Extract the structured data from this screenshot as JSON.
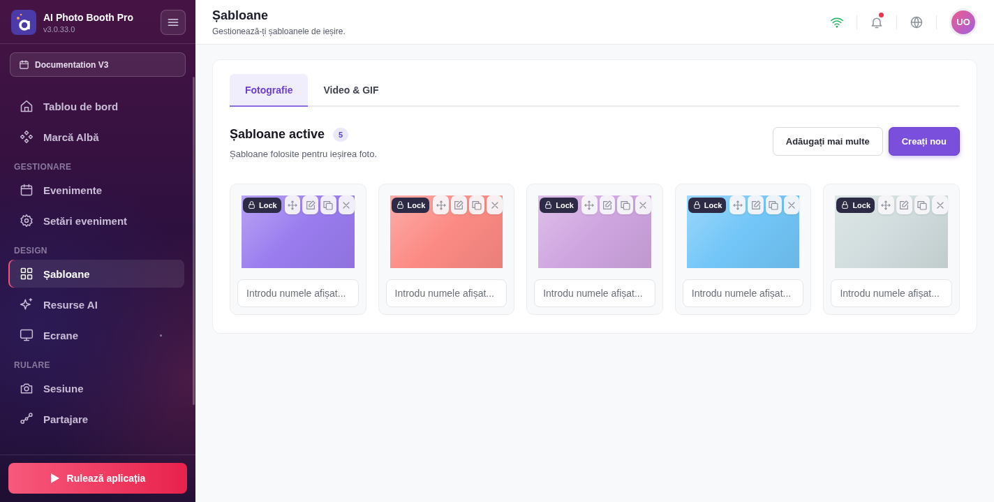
{
  "app": {
    "name": "AI Photo Booth Pro",
    "version": "v3.0.33.0"
  },
  "event_selector": {
    "label": "Documentation V3"
  },
  "sidebar": {
    "sections": [
      {
        "items": [
          {
            "label": "Tablou de bord",
            "selected": false,
            "indicator": false
          },
          {
            "label": "Marcă Albă",
            "selected": false,
            "indicator": false
          }
        ]
      },
      {
        "heading": "GESTIONARE",
        "items": [
          {
            "label": "Evenimente",
            "selected": false,
            "indicator": false
          },
          {
            "label": "Setări eveniment",
            "selected": false,
            "indicator": false
          }
        ]
      },
      {
        "heading": "DESIGN",
        "items": [
          {
            "label": "Șabloane",
            "selected": true,
            "indicator": false
          },
          {
            "label": "Resurse AI",
            "selected": false,
            "indicator": false
          },
          {
            "label": "Ecrane",
            "selected": false,
            "indicator": true
          }
        ]
      },
      {
        "heading": "RULARE",
        "items": [
          {
            "label": "Sesiune",
            "selected": false,
            "indicator": false
          },
          {
            "label": "Partajare",
            "selected": false,
            "indicator": false
          }
        ]
      }
    ]
  },
  "run_button": {
    "label": "Rulează aplicația"
  },
  "header": {
    "title": "Șabloane",
    "subtitle": "Gestionează-ți șabloanele de ieșire.",
    "online": true,
    "unread_notifications": true,
    "avatar": "UO"
  },
  "tabs": [
    {
      "label": "Fotografie",
      "selected": true
    },
    {
      "label": "Video & GIF",
      "selected": false
    }
  ],
  "section": {
    "title": "Șabloane active",
    "count": "5",
    "description": "Șabloane folosite pentru ieșirea foto.",
    "buttons": [
      {
        "label": "Adăugați mai multe",
        "kind": "secondary"
      },
      {
        "label": "Creați nou",
        "kind": "primary"
      }
    ]
  },
  "templates": [
    {
      "lock_label": "Lock",
      "color": "#9a7cef",
      "placeholder": "Introdu numele afișat..."
    },
    {
      "lock_label": "Lock",
      "color": "#fc8a84",
      "placeholder": "Introdu numele afișat..."
    },
    {
      "lock_label": "Lock",
      "color": "#cfa5e0",
      "placeholder": "Introdu numele afișat..."
    },
    {
      "lock_label": "Lock",
      "color": "#72c6f8",
      "placeholder": "Introdu numele afișat..."
    },
    {
      "lock_label": "Lock",
      "color": "#d0dcdd",
      "placeholder": "Introdu numele afișat..."
    }
  ]
}
